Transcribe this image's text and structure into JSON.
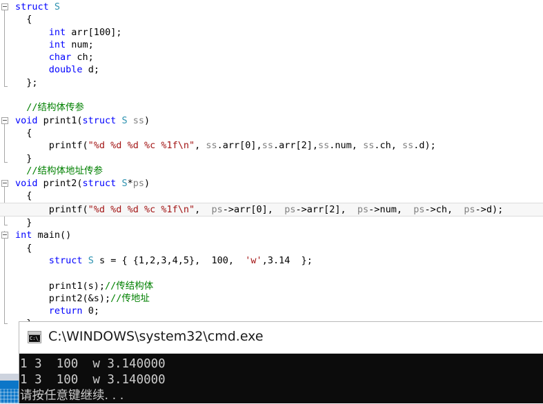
{
  "editor": {
    "name": "visual-studio-code-editor",
    "colors": {
      "keyword": "#0000ff",
      "type": "#2b91af",
      "string": "#a31515",
      "comment": "#008000",
      "plain": "#000000",
      "member": "#808080",
      "current_line_bg": "#f7f7f7"
    },
    "lines": [
      {
        "fold": true,
        "tokens": [
          {
            "t": "struct ",
            "c": "kw"
          },
          {
            "t": "S",
            "c": "type"
          }
        ]
      },
      {
        "tokens": [
          {
            "t": "  {",
            "c": "pl"
          }
        ]
      },
      {
        "tokens": [
          {
            "t": "      ",
            "c": "pl"
          },
          {
            "t": "int",
            "c": "kw"
          },
          {
            "t": " arr[100];",
            "c": "pl"
          }
        ]
      },
      {
        "tokens": [
          {
            "t": "      ",
            "c": "pl"
          },
          {
            "t": "int",
            "c": "kw"
          },
          {
            "t": " num;",
            "c": "pl"
          }
        ]
      },
      {
        "tokens": [
          {
            "t": "      ",
            "c": "pl"
          },
          {
            "t": "char",
            "c": "kw"
          },
          {
            "t": " ch;",
            "c": "pl"
          }
        ]
      },
      {
        "tokens": [
          {
            "t": "      ",
            "c": "pl"
          },
          {
            "t": "double",
            "c": "kw"
          },
          {
            "t": " d;",
            "c": "pl"
          }
        ]
      },
      {
        "tokens": [
          {
            "t": "  };",
            "c": "pl"
          }
        ]
      },
      {
        "tokens": []
      },
      {
        "tokens": [
          {
            "t": "  //结构体传参",
            "c": "cmt"
          }
        ]
      },
      {
        "fold": true,
        "tokens": [
          {
            "t": "void",
            "c": "kw"
          },
          {
            "t": " print1(",
            "c": "pl"
          },
          {
            "t": "struct",
            "c": "kw"
          },
          {
            "t": " ",
            "c": "pl"
          },
          {
            "t": "S",
            "c": "type"
          },
          {
            "t": " ",
            "c": "pl"
          },
          {
            "t": "ss",
            "c": "var"
          },
          {
            "t": ")",
            "c": "pl"
          }
        ]
      },
      {
        "tokens": [
          {
            "t": "  {",
            "c": "pl"
          }
        ]
      },
      {
        "tokens": [
          {
            "t": "      printf(",
            "c": "pl"
          },
          {
            "t": "\"%d %d %d %c %1f\\n\"",
            "c": "str"
          },
          {
            "t": ", ",
            "c": "pl"
          },
          {
            "t": "ss",
            "c": "var"
          },
          {
            "t": ".",
            "c": "pl"
          },
          {
            "t": "arr",
            "c": "pl"
          },
          {
            "t": "[0],",
            "c": "pl"
          },
          {
            "t": "ss",
            "c": "var"
          },
          {
            "t": ".",
            "c": "pl"
          },
          {
            "t": "arr",
            "c": "pl"
          },
          {
            "t": "[2],",
            "c": "pl"
          },
          {
            "t": "ss",
            "c": "var"
          },
          {
            "t": ".",
            "c": "pl"
          },
          {
            "t": "num",
            "c": "pl"
          },
          {
            "t": ", ",
            "c": "pl"
          },
          {
            "t": "ss",
            "c": "var"
          },
          {
            "t": ".",
            "c": "pl"
          },
          {
            "t": "ch",
            "c": "pl"
          },
          {
            "t": ", ",
            "c": "pl"
          },
          {
            "t": "ss",
            "c": "var"
          },
          {
            "t": ".",
            "c": "pl"
          },
          {
            "t": "d",
            "c": "pl"
          },
          {
            "t": ");",
            "c": "pl"
          }
        ]
      },
      {
        "tokens": [
          {
            "t": "  }",
            "c": "pl"
          }
        ]
      },
      {
        "tokens": [
          {
            "t": "  //结构体地址传参",
            "c": "cmt"
          }
        ]
      },
      {
        "fold": true,
        "tokens": [
          {
            "t": "void",
            "c": "kw"
          },
          {
            "t": " print2(",
            "c": "pl"
          },
          {
            "t": "struct",
            "c": "kw"
          },
          {
            "t": " ",
            "c": "pl"
          },
          {
            "t": "S",
            "c": "type"
          },
          {
            "t": "*",
            "c": "pl"
          },
          {
            "t": "ps",
            "c": "var"
          },
          {
            "t": ")",
            "c": "pl"
          }
        ]
      },
      {
        "tokens": [
          {
            "t": "  {",
            "c": "pl"
          }
        ]
      },
      {
        "current": true,
        "tokens": [
          {
            "t": "      printf(",
            "c": "pl"
          },
          {
            "t": "\"%d %d %d %c %1f\\n\"",
            "c": "str"
          },
          {
            "t": ",  ",
            "c": "pl"
          },
          {
            "t": "ps",
            "c": "var"
          },
          {
            "t": "->",
            "c": "pl"
          },
          {
            "t": "arr",
            "c": "pl"
          },
          {
            "t": "[0],  ",
            "c": "pl"
          },
          {
            "t": "ps",
            "c": "var"
          },
          {
            "t": "->",
            "c": "pl"
          },
          {
            "t": "arr",
            "c": "pl"
          },
          {
            "t": "[2],  ",
            "c": "pl"
          },
          {
            "t": "ps",
            "c": "var"
          },
          {
            "t": "->",
            "c": "pl"
          },
          {
            "t": "num",
            "c": "pl"
          },
          {
            "t": ",  ",
            "c": "pl"
          },
          {
            "t": "ps",
            "c": "var"
          },
          {
            "t": "->",
            "c": "pl"
          },
          {
            "t": "ch",
            "c": "pl"
          },
          {
            "t": ",  ",
            "c": "pl"
          },
          {
            "t": "ps",
            "c": "var"
          },
          {
            "t": "->",
            "c": "pl"
          },
          {
            "t": "d",
            "c": "pl"
          },
          {
            "t": ");",
            "c": "pl"
          }
        ]
      },
      {
        "tokens": [
          {
            "t": "  }",
            "c": "pl"
          }
        ]
      },
      {
        "fold": true,
        "tokens": [
          {
            "t": "int",
            "c": "kw"
          },
          {
            "t": " main()",
            "c": "pl"
          }
        ]
      },
      {
        "tokens": [
          {
            "t": "  {",
            "c": "pl"
          }
        ]
      },
      {
        "tokens": [
          {
            "t": "      ",
            "c": "pl"
          },
          {
            "t": "struct",
            "c": "kw"
          },
          {
            "t": " ",
            "c": "pl"
          },
          {
            "t": "S",
            "c": "type"
          },
          {
            "t": " s = { {1,2,3,4,5},  100,  ",
            "c": "pl"
          },
          {
            "t": "'w'",
            "c": "str"
          },
          {
            "t": ",3.14  };",
            "c": "pl"
          }
        ]
      },
      {
        "tokens": []
      },
      {
        "tokens": [
          {
            "t": "      print1(s);",
            "c": "pl"
          },
          {
            "t": "//传结构体",
            "c": "cmt"
          }
        ]
      },
      {
        "tokens": [
          {
            "t": "      print2(&s);",
            "c": "pl"
          },
          {
            "t": "//传地址",
            "c": "cmt"
          }
        ]
      },
      {
        "tokens": [
          {
            "t": "      ",
            "c": "pl"
          },
          {
            "t": "return",
            "c": "kw"
          },
          {
            "t": " 0;",
            "c": "pl"
          }
        ]
      },
      {
        "tokens": [
          {
            "t": "  }",
            "c": "pl"
          }
        ]
      }
    ],
    "combo_icon": "chevron-down-icon"
  },
  "console": {
    "icon": "cmd-console-icon",
    "icon_glyph": "C:\\_",
    "title": "C:\\WINDOWS\\system32\\cmd.exe",
    "output_lines": [
      "1 3  100  w 3.140000",
      "1 3  100  w 3.140000",
      "请按任意键继续. . ."
    ]
  }
}
